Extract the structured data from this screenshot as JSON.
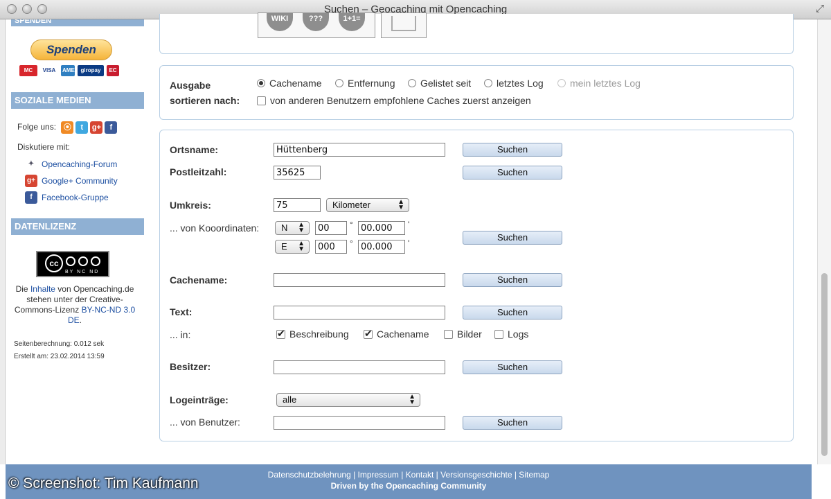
{
  "window": {
    "title": "Suchen – Geocaching mit Opencaching"
  },
  "sidebar": {
    "spenden_header": "SPENDEN",
    "donate_button": "Spenden",
    "payment": [
      "MC",
      "VISA",
      "AMEX",
      "giropay",
      "EC"
    ],
    "social_header": "SOZIALE MEDIEN",
    "follow_label": "Folge uns:",
    "social_icons": [
      "rss-icon",
      "twitter-icon",
      "google-plus-icon",
      "facebook-icon"
    ],
    "discuss_label": "Diskutiere mit:",
    "links": [
      {
        "label": "Opencaching-Forum",
        "icon": "opencaching-icon"
      },
      {
        "label": "Google+ Community",
        "icon": "google-plus-icon"
      },
      {
        "label": "Facebook-Gruppe",
        "icon": "facebook-icon"
      }
    ],
    "license_header": "DATENLIZENZ",
    "cc_badge_text": "BY NC ND",
    "license_text": {
      "prefix": "Die ",
      "link1": "Inhalte",
      "middle": " von Opencaching.de stehen unter der Creative-Commons-Lizenz ",
      "link2": "BY-NC-ND 3.0 DE",
      "suffix": "."
    },
    "page_calc": "Seitenberechnung: 0.012 sek",
    "created": "Erstellt am: 23.02.2014 13:59"
  },
  "top_icons": [
    "WIKI",
    "???",
    "1+1="
  ],
  "sort": {
    "label_line1": "Ausgabe",
    "label_line2": "sortieren nach:",
    "options": [
      "Cachename",
      "Entfernung",
      "Gelistet seit",
      "letztes Log",
      "mein letztes Log"
    ],
    "selected": "Cachename",
    "recommend_label": "von anderen Benutzern empfohlene Caches zuerst anzeigen"
  },
  "search": {
    "button_label": "Suchen",
    "ortsname_label": "Ortsname:",
    "ortsname_value": "Hüttenberg",
    "plz_label": "Postleitzahl:",
    "plz_value": "35625",
    "umkreis_label": "Umkreis:",
    "umkreis_value": "75",
    "unit_value": "Kilometer",
    "coords_label": "... von Kooordinaten:",
    "lat_dir": "N",
    "lat_deg": "00",
    "lat_min": "00.000",
    "lon_dir": "E",
    "lon_deg": "000",
    "lon_min": "00.000",
    "deg_symbol": "°",
    "min_symbol": "'",
    "cachename_label": "Cachename:",
    "cachename_value": "",
    "text_label": "Text:",
    "text_value": "",
    "in_label": "... in:",
    "in_options": [
      {
        "label": "Beschreibung",
        "checked": true
      },
      {
        "label": "Cachename",
        "checked": true
      },
      {
        "label": "Bilder",
        "checked": false
      },
      {
        "label": "Logs",
        "checked": false
      }
    ],
    "besitzer_label": "Besitzer:",
    "besitzer_value": "",
    "logeintraege_label": "Logeinträge:",
    "logeintraege_value": "alle",
    "benutzer_label": "... von Benutzer:",
    "benutzer_value": ""
  },
  "footer": {
    "links": "Datenschutzbelehrung | Impressum | Kontakt | Versionsgeschichte | Sitemap",
    "driven": "Driven by the Opencaching Community"
  },
  "watermark": "© Screenshot: Tim Kaufmann"
}
